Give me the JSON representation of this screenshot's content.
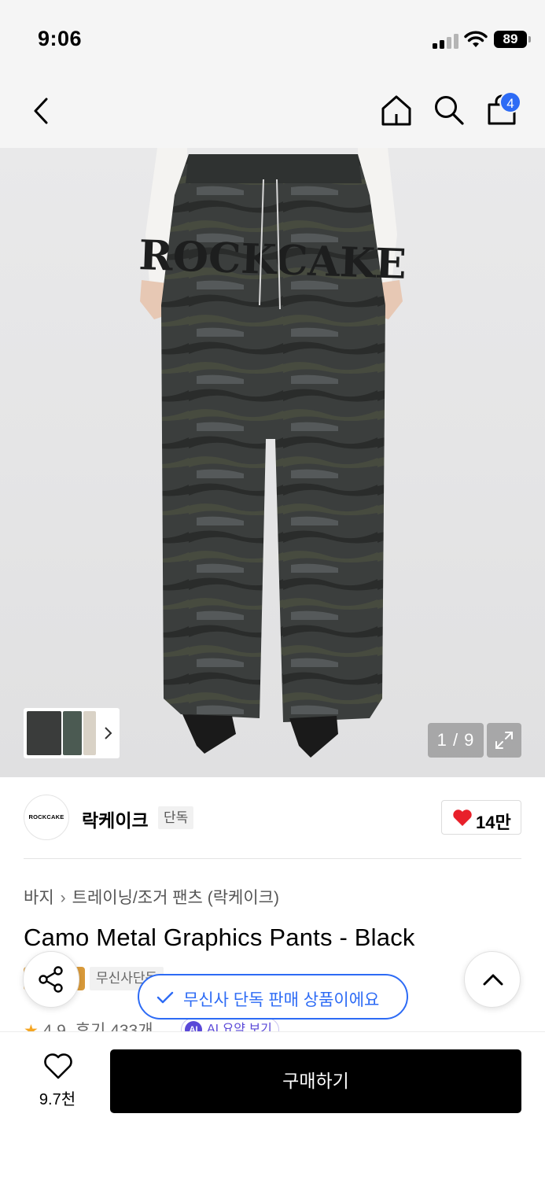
{
  "status_bar": {
    "time": "9:06",
    "battery": "89"
  },
  "nav": {
    "cart_count": "4"
  },
  "gallery": {
    "page_indicator": "1 / 9"
  },
  "brand": {
    "logo_text": "ROCKCAKE",
    "name": "락케이크",
    "tag": "단독",
    "likes": "14만"
  },
  "breadcrumb": {
    "category": "바지",
    "subcategory": "트레이닝/조거 팬츠 (락케이크)"
  },
  "product": {
    "title": "Camo Metal Graphics Pants - Black",
    "partial_tag": "무신사단독"
  },
  "rating": {
    "score": "4.9",
    "reviews": "후기 433개",
    "ai_label": "AI",
    "ai_summary": "AI 요약 보기"
  },
  "toast": {
    "text": "무신사 단독 판매 상품이에요"
  },
  "bottom_bar": {
    "wish_count": "9.7천",
    "buy_label": "구매하기"
  },
  "colors": {
    "accent_blue": "#2d6bf5",
    "heart_red": "#e8202a",
    "buy_button": "#000000"
  }
}
